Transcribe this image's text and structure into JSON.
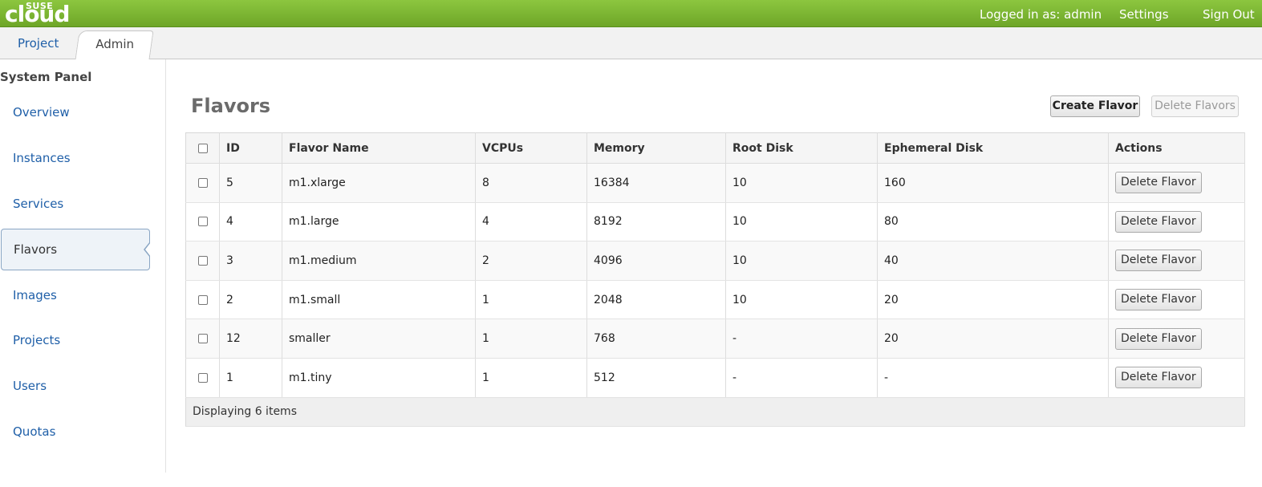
{
  "header": {
    "logo_top": "SUSE",
    "logo_main": "cloud",
    "user_label": "Logged in as: admin",
    "settings_label": "Settings",
    "signout_label": "Sign Out"
  },
  "tabs": [
    {
      "label": "Project"
    },
    {
      "label": "Admin"
    }
  ],
  "sidebar": {
    "title": "System Panel",
    "items": [
      {
        "label": "Overview"
      },
      {
        "label": "Instances"
      },
      {
        "label": "Services"
      },
      {
        "label": "Flavors"
      },
      {
        "label": "Images"
      },
      {
        "label": "Projects"
      },
      {
        "label": "Users"
      },
      {
        "label": "Quotas"
      }
    ]
  },
  "main": {
    "title": "Flavors",
    "create_label": "Create Flavor",
    "delete_all_label": "Delete Flavors",
    "table": {
      "headers": [
        "ID",
        "Flavor Name",
        "VCPUs",
        "Memory",
        "Root Disk",
        "Ephemeral Disk",
        "Actions"
      ],
      "rows": [
        {
          "id": "5",
          "name": "m1.xlarge",
          "vcpus": "8",
          "memory": "16384",
          "root": "10",
          "ephemeral": "160",
          "action": "Delete Flavor"
        },
        {
          "id": "4",
          "name": "m1.large",
          "vcpus": "4",
          "memory": "8192",
          "root": "10",
          "ephemeral": "80",
          "action": "Delete Flavor"
        },
        {
          "id": "3",
          "name": "m1.medium",
          "vcpus": "2",
          "memory": "4096",
          "root": "10",
          "ephemeral": "40",
          "action": "Delete Flavor"
        },
        {
          "id": "2",
          "name": "m1.small",
          "vcpus": "1",
          "memory": "2048",
          "root": "10",
          "ephemeral": "20",
          "action": "Delete Flavor"
        },
        {
          "id": "12",
          "name": "smaller",
          "vcpus": "1",
          "memory": "768",
          "root": "-",
          "ephemeral": "20",
          "action": "Delete Flavor"
        },
        {
          "id": "1",
          "name": "m1.tiny",
          "vcpus": "1",
          "memory": "512",
          "root": "-",
          "ephemeral": "-",
          "action": "Delete Flavor"
        }
      ],
      "footer": "Displaying 6 items"
    }
  }
}
